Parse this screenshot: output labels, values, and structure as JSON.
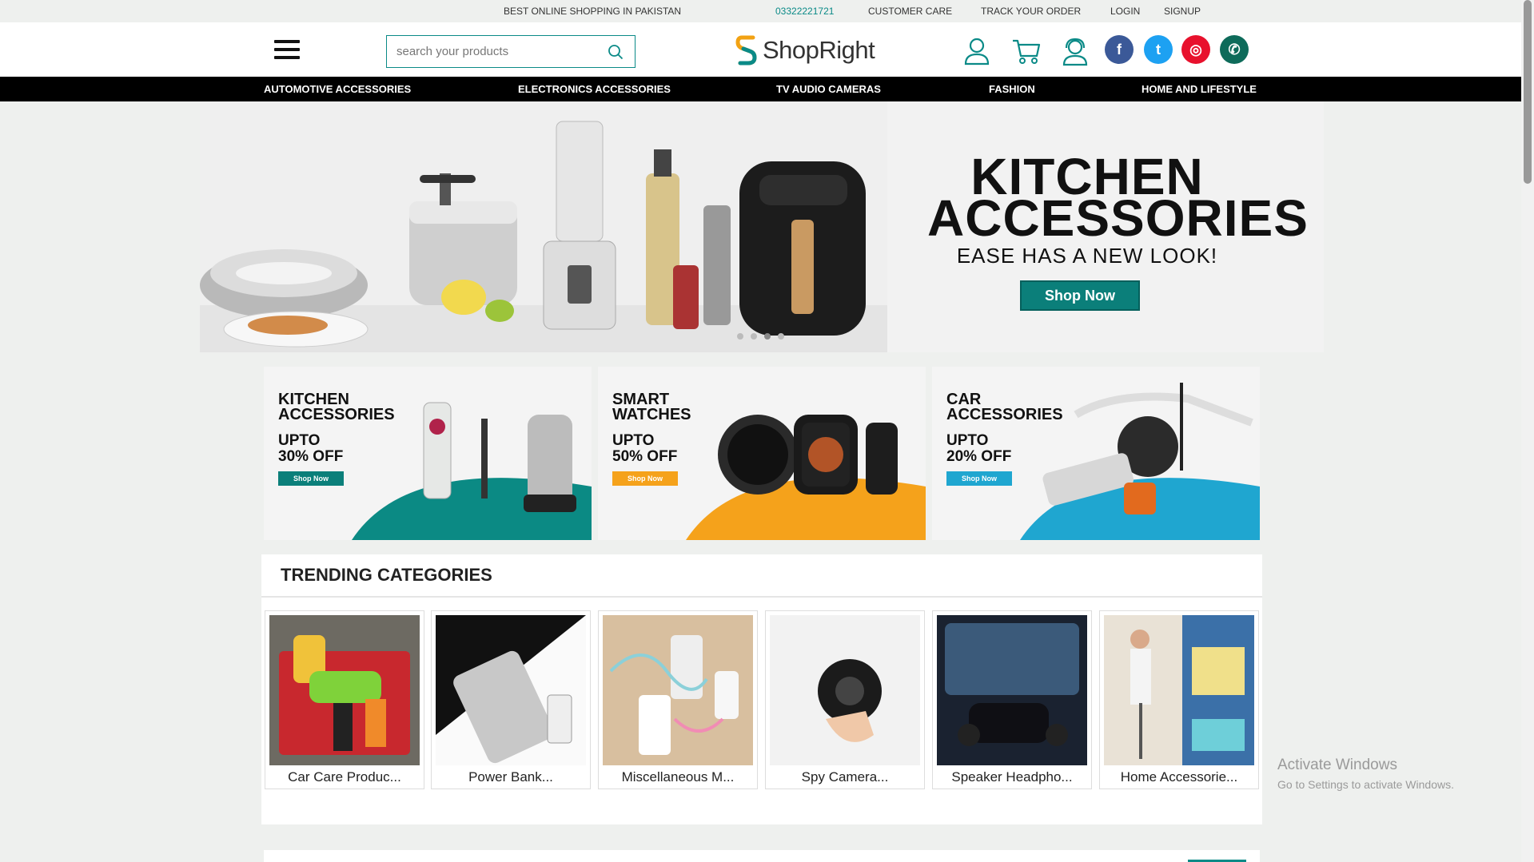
{
  "topbar": {
    "tagline": "BEST ONLINE SHOPPING IN PAKISTAN",
    "phone": "03322221721",
    "customer_care": "CUSTOMER CARE",
    "track_order": "TRACK YOUR ORDER",
    "login": "LOGIN",
    "signup": "SIGNUP"
  },
  "header": {
    "search_placeholder": "search your products",
    "brand": "ShopRight",
    "icons": [
      "menu-icon",
      "search-icon",
      "user-icon",
      "cart-icon",
      "support-icon"
    ],
    "social": [
      {
        "name": "facebook",
        "glyph": "f",
        "color": "#3b5998"
      },
      {
        "name": "twitter",
        "glyph": "t",
        "color": "#1da1f2"
      },
      {
        "name": "instagram",
        "glyph": "◎",
        "color": "#e8112d"
      },
      {
        "name": "whatsapp",
        "glyph": "✆",
        "color": "#0e6b5a"
      }
    ]
  },
  "nav": [
    "AUTOMOTIVE ACCESSORIES",
    "ELECTRONICS ACCESSORIES",
    "TV AUDIO CAMERAS",
    "FASHION",
    "HOME AND LIFESTYLE"
  ],
  "hero": {
    "title_line1": "KITCHEN",
    "title_line2": "ACCESSORIES",
    "subtitle": "EASE HAS A NEW LOOK!",
    "cta": "Shop Now",
    "slides": 4,
    "active_slide": 3
  },
  "promos": [
    {
      "title_line1": "KITCHEN",
      "title_line2": "ACCESSORIES",
      "offer_line1": "UPTO",
      "offer_line2": "30% OFF",
      "cta": "Shop Now",
      "accent": "#0b8a84"
    },
    {
      "title_line1": "SMART",
      "title_line2": "WATCHES",
      "offer_line1": "UPTO",
      "offer_line2": "50% OFF",
      "cta": "Shop Now",
      "accent": "#f5a21b"
    },
    {
      "title_line1": "CAR",
      "title_line2": "ACCESSORIES",
      "offer_line1": "UPTO",
      "offer_line2": "20% OFF",
      "cta": "Shop Now",
      "accent": "#1fa6d0"
    }
  ],
  "trending": {
    "heading": "TRENDING CATEGORIES",
    "items": [
      "Car Care Produc...",
      "Power Bank...",
      "Miscellaneous M...",
      "Spy Camera...",
      "Speaker Headpho...",
      "Home Accessorie..."
    ]
  },
  "watermark": {
    "line1": "Activate Windows",
    "line2": "Go to Settings to activate Windows."
  }
}
